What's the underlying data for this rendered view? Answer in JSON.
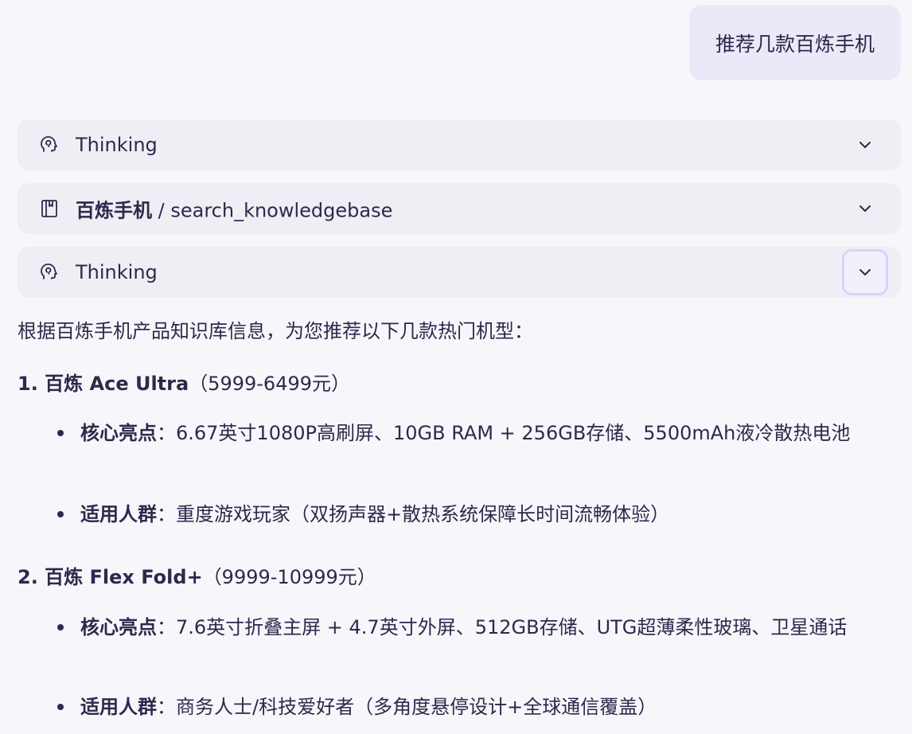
{
  "user_message": "推荐几款百炼手机",
  "steps": [
    {
      "icon": "brain-icon",
      "label": "Thinking"
    },
    {
      "icon": "book-icon",
      "label_bold": "百炼手机",
      "label_rest": " / search_knowledgebase"
    },
    {
      "icon": "brain-icon",
      "label": "Thinking"
    }
  ],
  "answer": {
    "intro": "根据百炼手机产品知识库信息，为您推荐以下几款热门机型：",
    "products": [
      {
        "title": "1. 百炼 Ace Ultra",
        "price": "（5999-6499元）",
        "highlights_label": "核心亮点",
        "highlights": "：6.67英寸1080P高刷屏、10GB RAM + 256GB存储、5500mAh液冷散热电池",
        "audience_label": "适用人群",
        "audience": "：重度游戏玩家（双扬声器+散热系统保障长时间流畅体验）"
      },
      {
        "title": "2. 百炼 Flex Fold+",
        "price": "（9999-10999元）",
        "highlights_label": "核心亮点",
        "highlights": "：7.6英寸折叠主屏 + 4.7英寸外屏、512GB存储、UTG超薄柔性玻璃、卫星通话",
        "audience_label": "适用人群",
        "audience": "：商务人士/科技爱好者（多角度悬停设计+全球通信覆盖）"
      }
    ]
  }
}
